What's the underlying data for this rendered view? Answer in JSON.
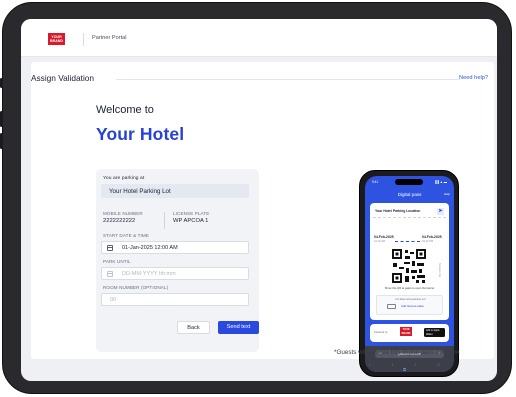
{
  "header": {
    "logo_text": "YOUR BRAND",
    "portal_title": "Partner Portal"
  },
  "page": {
    "title": "Assign Validation",
    "help_link": "Need help?",
    "welcome": "Welcome to",
    "hotel_name": "Your Hotel"
  },
  "form": {
    "parking_label": "You are parking at",
    "parking_lot": "Your Hotel Parking Lot",
    "mobile_label": "MOBILE NUMBER",
    "mobile_value": "2222222222",
    "plate_label": "LICENSE PLATE",
    "plate_value": "WP APCOA 1",
    "start_label": "START DATE & TIME",
    "start_value": "01-Jan-2025 12:00 AM",
    "until_label": "PARK UNTIL",
    "until_placeholder": "DD-MM-YYYY hh:mm",
    "room_label": "ROOM NUMBER (OPTIONAL)",
    "room_placeholder": "00",
    "back_button": "Back",
    "send_button": "Send text"
  },
  "phone": {
    "status_time": "9:41",
    "status_icons": "▐▐ ▲ ▬",
    "title": "Digital pass",
    "help": "Help",
    "location": "Your Hotel Parking Location",
    "start_date": "04-Feb-2025",
    "start_time": "10:10 AM",
    "end_date": "04-Feb-2025",
    "end_time": "04:10 PM",
    "qr_note": "Show this QR at gates to open the barrier",
    "side_label": "Sample only",
    "faster_text": "For faster and seamless exit",
    "add_plate": "Add license plate",
    "powered_by": "Powered by",
    "brand_logo": "YOUR BRAND",
    "wallet": "Add to Apple Wallet",
    "url_aa": "AA",
    "url": "yourbrand.com",
    "nav_icons": "‹ › ↑ □ ⧉"
  },
  "footer": {
    "guests_note": "*Guests will receive this digital pass over text"
  }
}
